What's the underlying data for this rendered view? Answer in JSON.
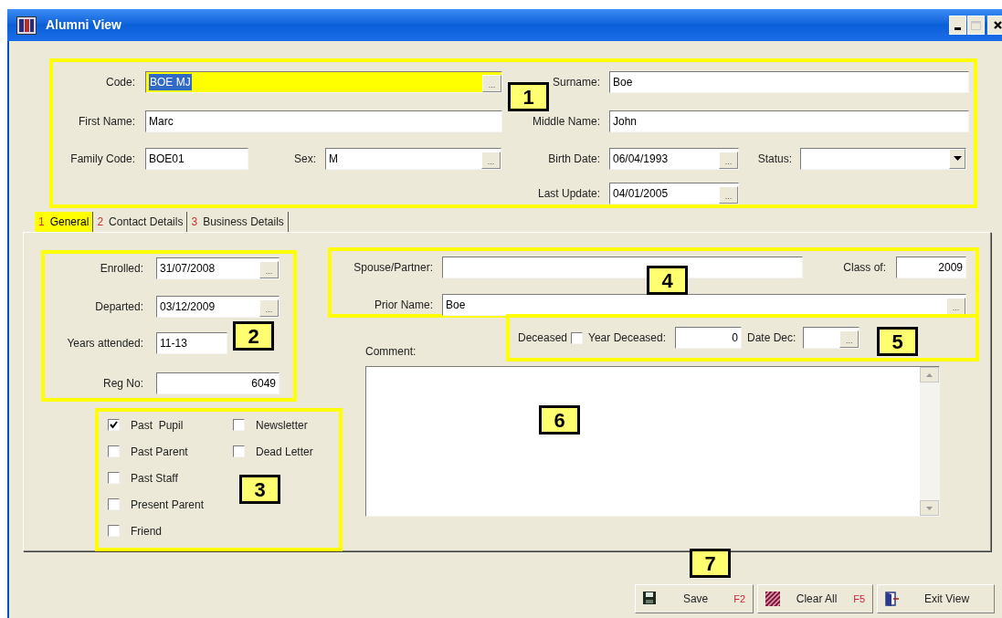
{
  "window": {
    "title": "Alumni View"
  },
  "header": {
    "fields": [
      {
        "label": "Code:",
        "kind": "lookup",
        "value": "BOE MJ",
        "button": "...",
        "focused": true
      },
      {
        "label": "Surname:",
        "kind": "text",
        "value": "Boe",
        "focused": false
      },
      {
        "label": "First Name:",
        "kind": "text",
        "value": "Marc",
        "focused": false
      },
      {
        "label": "Middle Name:",
        "kind": "text",
        "value": "John",
        "focused": false
      },
      {
        "label": "Family Code:",
        "kind": "text",
        "value": "BOE01",
        "focused": false
      },
      {
        "label": "Sex:",
        "kind": "lookup",
        "value": "M",
        "button": "...",
        "focused": false
      },
      {
        "label": "Birth Date:",
        "kind": "lookup",
        "value": "06/04/1993",
        "button": "...",
        "focused": false
      },
      {
        "label": "Status:",
        "kind": "dropdown",
        "focused": false
      },
      {
        "label": "Last Update:",
        "kind": "lookup",
        "value": "04/01/2005",
        "button": "...",
        "focused": false
      }
    ]
  },
  "tabs": [
    {
      "number": "1",
      "label": "General",
      "selected": true
    },
    {
      "number": "2",
      "label": "Contact Details",
      "selected": false
    },
    {
      "number": "3",
      "label": "Business Details",
      "selected": false
    }
  ],
  "general": {
    "left_fields": [
      {
        "label": "Enrolled:",
        "kind": "lookup",
        "value": "31/07/2008",
        "button": "..."
      },
      {
        "label": "Departed:",
        "kind": "lookup",
        "value": "03/12/2009",
        "button": "..."
      },
      {
        "label": "Years attended:",
        "kind": "text",
        "value": "11-13"
      },
      {
        "label": "Reg No:",
        "kind": "number",
        "value": "6049"
      }
    ],
    "flags": [
      {
        "label": "Past  Pupil",
        "checked": true
      },
      {
        "label": "Newsletter",
        "checked": false
      },
      {
        "label": "Past Parent",
        "checked": false
      },
      {
        "label": "Dead Letter",
        "checked": false
      },
      {
        "label": "Past Staff",
        "checked": false
      },
      {
        "label": "Present Parent",
        "checked": false
      },
      {
        "label": "Friend",
        "checked": false
      }
    ],
    "right_fields": [
      {
        "label": "Spouse/Partner:",
        "kind": "text"
      },
      {
        "label": "Class of:",
        "kind": "number",
        "value": "2009"
      },
      {
        "label": "Prior Name:",
        "kind": "lookup",
        "value": "Boe",
        "button": "..."
      }
    ],
    "deceased": {
      "label": "Deceased",
      "checked": false
    },
    "death_fields": [
      {
        "label": "Year Deceased:",
        "kind": "number",
        "value": "0"
      },
      {
        "label": "Date Dec:",
        "kind": "lookup",
        "button": "..."
      }
    ],
    "comment": {
      "label": "Comment:"
    }
  },
  "callouts": [
    "1",
    "2",
    "3",
    "4",
    "5",
    "6",
    "7"
  ],
  "buttons": [
    {
      "kind": "save",
      "label": "Save",
      "shortcut": "F2"
    },
    {
      "kind": "clear",
      "label": "Clear All",
      "shortcut": "F5"
    },
    {
      "kind": "exit",
      "label": "Exit View"
    }
  ]
}
